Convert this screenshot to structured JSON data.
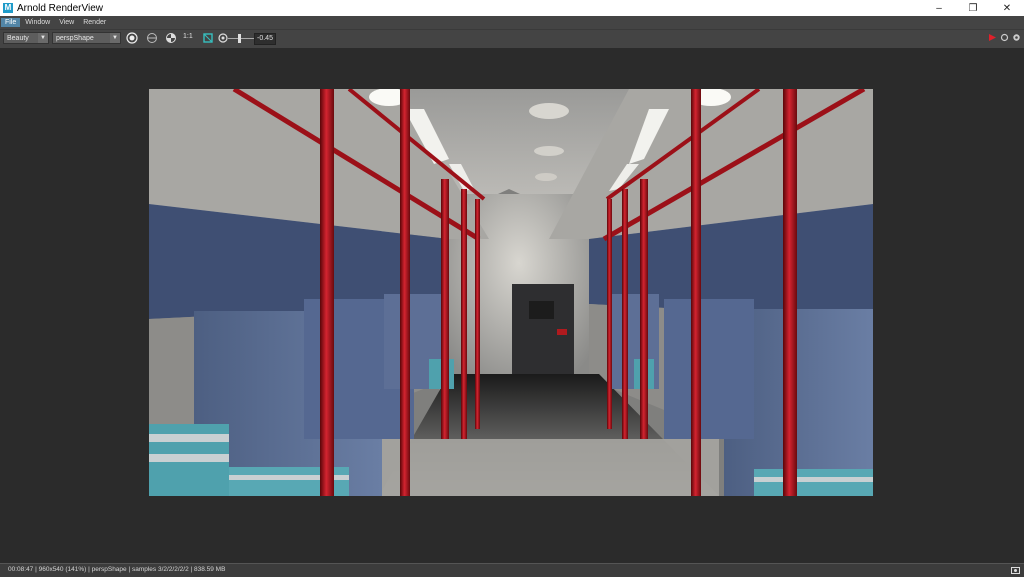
{
  "window": {
    "title": "Arnold RenderView",
    "icon_letter": "M"
  },
  "menu": {
    "items": [
      {
        "label": "File",
        "active": true
      },
      {
        "label": "Window"
      },
      {
        "label": "View"
      },
      {
        "label": "Render"
      }
    ]
  },
  "toolbar": {
    "aov_select": "Beauty",
    "camera_select": "perspShape",
    "ratio_label": "1:1",
    "exposure_value": "-0.45",
    "exposure_level": 0.5
  },
  "status": {
    "text": "00:08:47 | 960x540 (141%) | perspShape  | samples 3/2/2/2/2/2 | 838.59 MB"
  },
  "colors": {
    "accent": "#5285a6",
    "pole_red": "#b0141c",
    "seat_blue": "#5a6e94",
    "render_button": "#e0202a"
  },
  "icons": [
    "minimize-icon",
    "restore-icon",
    "close-icon",
    "render-settings-icon",
    "region-icon",
    "checker-icon",
    "crop-icon",
    "exposure-icon",
    "play-render-icon",
    "refresh-icon",
    "settings-gear-icon",
    "snapshot-icon"
  ]
}
